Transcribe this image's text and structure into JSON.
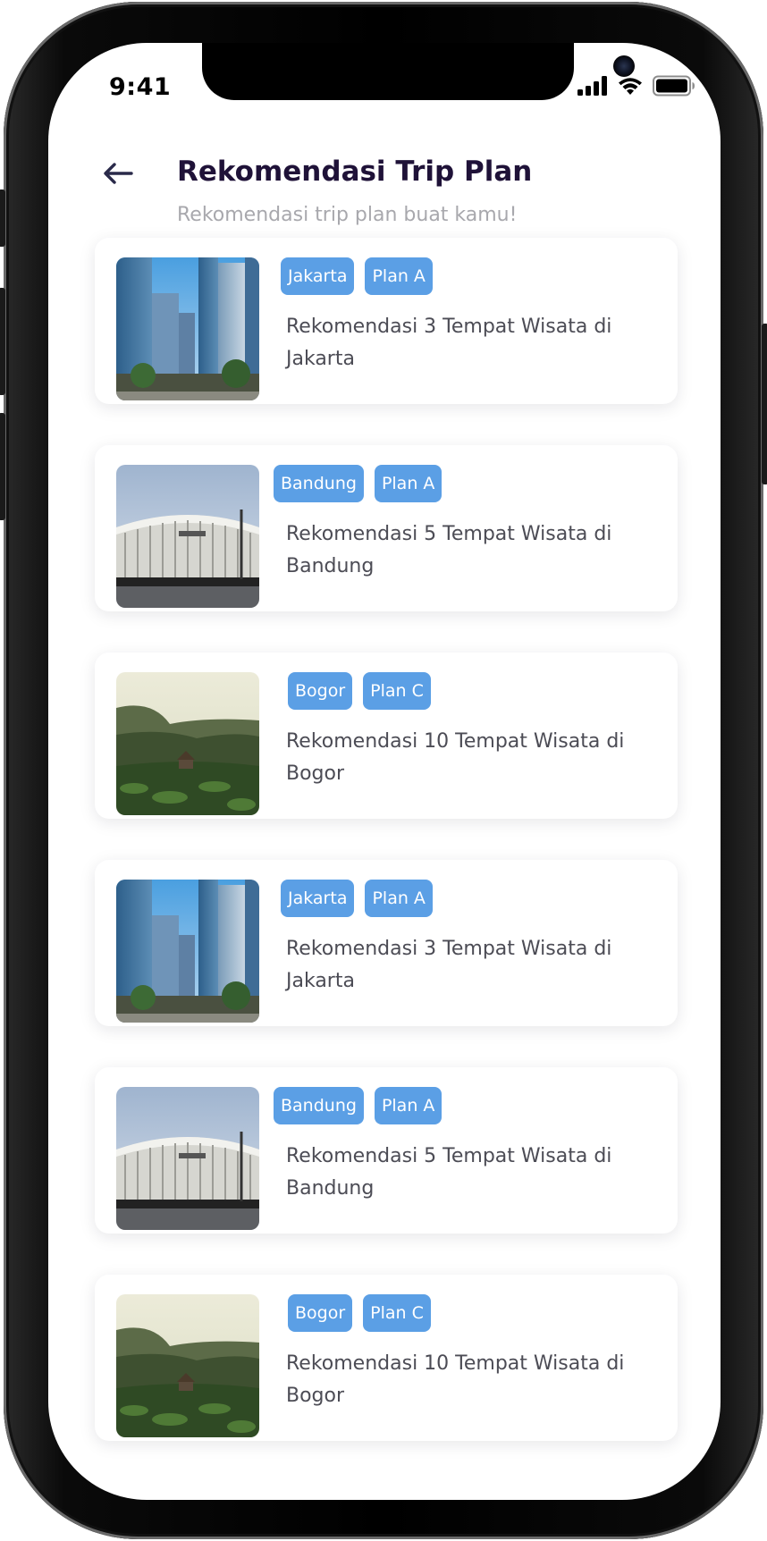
{
  "status_bar": {
    "time": "9:41",
    "icons": [
      "signal-icon",
      "wifi-icon",
      "battery-icon"
    ]
  },
  "header": {
    "back_icon": "arrow-left-icon",
    "title": "Rekomendasi Trip Plan",
    "subtitle": "Rekomendasi trip plan buat kamu!"
  },
  "colors": {
    "tag_background": "#5b9fe5",
    "title_color": "#1f1238",
    "subtitle_color": "#a8a8ad",
    "card_text": "#4c4c55"
  },
  "cards": [
    {
      "image": "jakarta-skyscrapers-photo",
      "tags": [
        "Jakarta",
        "Plan A"
      ],
      "title": "Rekomendasi 3 Tempat Wisata di Jakarta"
    },
    {
      "image": "bandung-stadium-photo",
      "tags": [
        "Bandung",
        "Plan A"
      ],
      "title": "Rekomendasi 5 Tempat Wisata di Bandung"
    },
    {
      "image": "bogor-forest-photo",
      "tags": [
        "Bogor",
        "Plan C"
      ],
      "title": "Rekomendasi 10 Tempat Wisata di Bogor"
    },
    {
      "image": "jakarta-skyscrapers-photo",
      "tags": [
        "Jakarta",
        "Plan A"
      ],
      "title": "Rekomendasi 3 Tempat Wisata di Jakarta"
    },
    {
      "image": "bandung-stadium-photo",
      "tags": [
        "Bandung",
        "Plan A"
      ],
      "title": "Rekomendasi 5 Tempat Wisata di Bandung"
    },
    {
      "image": "bogor-forest-photo",
      "tags": [
        "Bogor",
        "Plan C"
      ],
      "title": "Rekomendasi 10 Tempat Wisata di Bogor"
    }
  ]
}
